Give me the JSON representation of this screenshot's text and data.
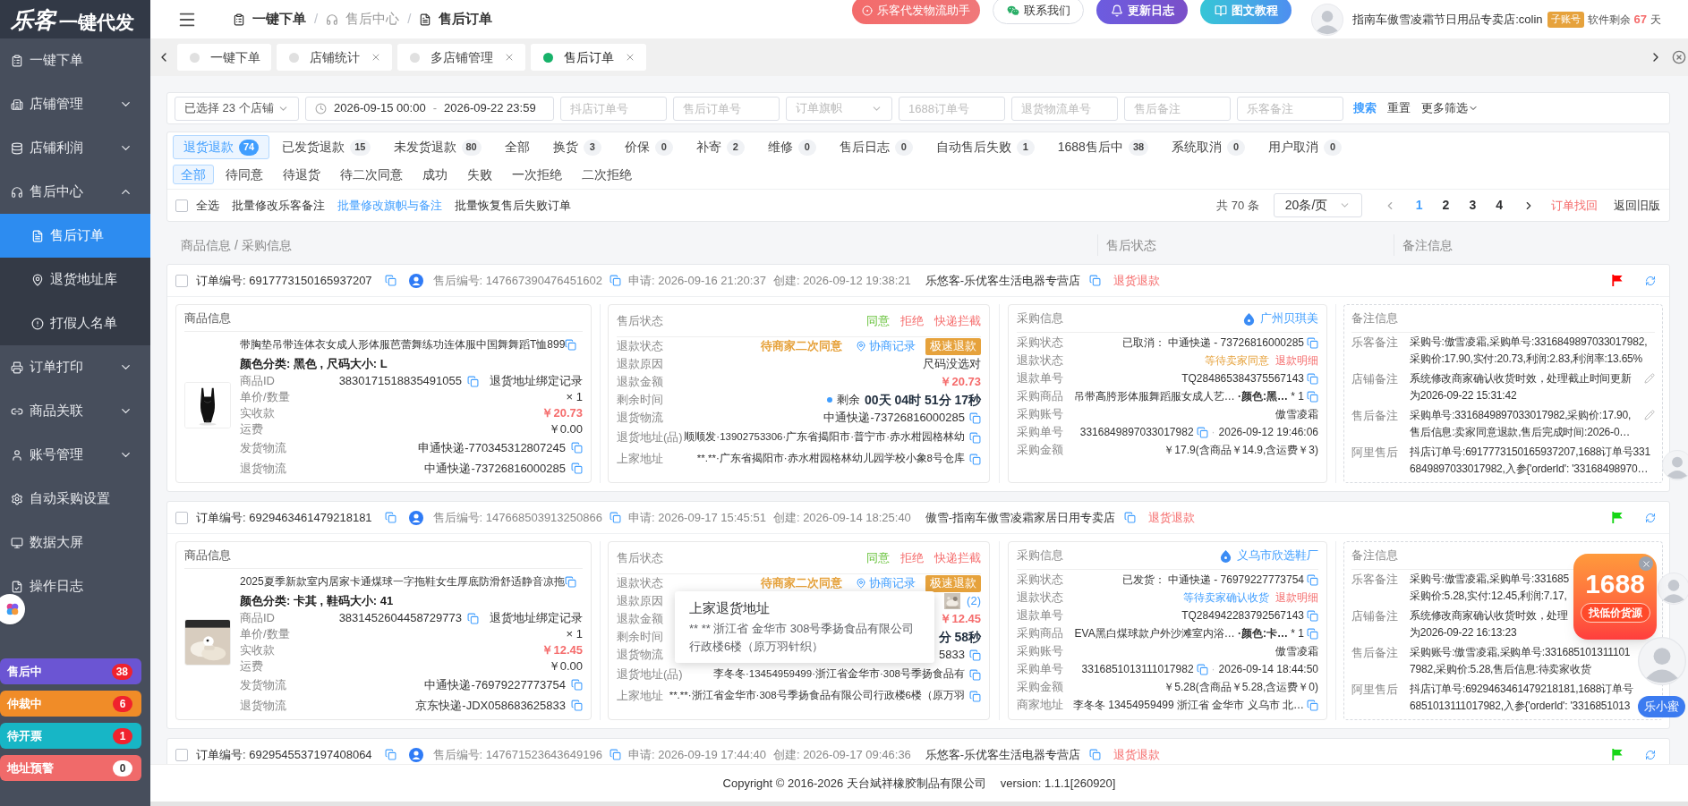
{
  "logo": {
    "brand": "乐客",
    "tagline": "一键代发"
  },
  "breadcrumb": {
    "separator": "/",
    "items": [
      {
        "label": "一键下单",
        "muted": false
      },
      {
        "label": "售后中心",
        "muted": true
      },
      {
        "label": "售后订单",
        "muted": false
      }
    ]
  },
  "header_buttons": [
    {
      "kind": "logistics",
      "label": "乐客代发物流助手"
    },
    {
      "kind": "contact",
      "label": "联系我们"
    },
    {
      "kind": "changelog",
      "label": "更新日志"
    },
    {
      "kind": "tutorial",
      "label": "图文教程"
    }
  ],
  "user": {
    "name": "指南车傲雪凌霜节日用品专卖店:colin",
    "badge": "子账号",
    "remaining": "软件剩余",
    "days": "67",
    "unit": "天"
  },
  "sidebar": {
    "items": [
      {
        "label": "一键下单",
        "selected": false
      },
      {
        "label": "店铺管理",
        "selected": false,
        "expanded": false
      },
      {
        "label": "店铺利润",
        "selected": false,
        "expanded": false
      },
      {
        "label": "售后中心",
        "selected": false,
        "expanded": true,
        "children": [
          {
            "label": "售后订单",
            "selected": true
          },
          {
            "label": "退货地址库",
            "selected": false
          },
          {
            "label": "打假人名单",
            "selected": false
          }
        ]
      },
      {
        "label": "订单打印",
        "selected": false,
        "expanded": false
      },
      {
        "label": "商品关联",
        "selected": false,
        "expanded": false
      },
      {
        "label": "账号管理",
        "selected": false,
        "expanded": false
      },
      {
        "label": "自动采购设置",
        "selected": false
      },
      {
        "label": "数据大屏",
        "selected": false
      },
      {
        "label": "操作日志",
        "selected": false
      }
    ],
    "counters": [
      {
        "label": "售后中",
        "count": "38",
        "alert": true,
        "color": "#6b55d3"
      },
      {
        "label": "仲裁中",
        "count": "6",
        "alert": true,
        "color": "#f08c28"
      },
      {
        "label": "待开票",
        "count": "1",
        "alert": true,
        "color": "#17b6c6"
      },
      {
        "label": "地址预警",
        "count": "0",
        "alert": false,
        "color": "#f06a6a"
      }
    ]
  },
  "page_tabs": [
    {
      "label": "一键下单",
      "selected": false,
      "closable": false
    },
    {
      "label": "店铺统计",
      "selected": false,
      "closable": true
    },
    {
      "label": "多店铺管理",
      "selected": false,
      "closable": true
    },
    {
      "label": "售后订单",
      "selected": true,
      "closable": true
    }
  ],
  "filters": {
    "store": "已选择 23 个店铺",
    "date_from": "2026-09-15 00:00",
    "date_separator": "-",
    "date_to": "2026-09-22 23:59",
    "fields": [
      {
        "kind": "input",
        "placeholder": "抖店订单号"
      },
      {
        "kind": "input",
        "placeholder": "售后订单号"
      },
      {
        "kind": "select",
        "placeholder": "订单旗帜"
      },
      {
        "kind": "input",
        "placeholder": "1688订单号"
      },
      {
        "kind": "input",
        "placeholder": "退货物流单号"
      },
      {
        "kind": "input",
        "placeholder": "售后备注"
      },
      {
        "kind": "input",
        "placeholder": "乐客备注"
      }
    ],
    "search": "搜索",
    "reset": "重置",
    "more": "更多筛选"
  },
  "type_tabs": [
    {
      "label": "退货退款",
      "count": "74",
      "selected": true
    },
    {
      "label": "已发货退款",
      "count": "15",
      "selected": false
    },
    {
      "label": "未发货退款",
      "count": "80",
      "selected": false
    },
    {
      "label": "全部",
      "selected": false
    },
    {
      "label": "换货",
      "count": "3",
      "selected": false
    },
    {
      "label": "价保",
      "count": "0",
      "selected": false
    },
    {
      "label": "补寄",
      "count": "2",
      "selected": false
    },
    {
      "label": "维修",
      "count": "0",
      "selected": false
    },
    {
      "label": "售后日志",
      "count": "0",
      "selected": false
    },
    {
      "label": "自动售后失败",
      "count": "1",
      "selected": false
    },
    {
      "label": "1688售后中",
      "count": "38",
      "selected": false
    },
    {
      "label": "系统取消",
      "count": "0",
      "selected": false
    },
    {
      "label": "用户取消",
      "count": "0",
      "selected": false
    }
  ],
  "sub_tabs": [
    {
      "label": "全部",
      "selected": true
    },
    {
      "label": "待同意",
      "selected": false
    },
    {
      "label": "待退货",
      "selected": false
    },
    {
      "label": "待二次同意",
      "selected": false
    },
    {
      "label": "成功",
      "selected": false
    },
    {
      "label": "失败",
      "selected": false
    },
    {
      "label": "一次拒绝",
      "selected": false
    },
    {
      "label": "二次拒绝",
      "selected": false
    }
  ],
  "toolbar": {
    "select_all": {
      "label": "全选",
      "checked": false
    },
    "actions": [
      {
        "label": "批量修改乐客备注",
        "kind": "plain"
      },
      {
        "label": "批量修改旗帜与备注",
        "kind": "link"
      },
      {
        "label": "批量恢复售后失败订单",
        "kind": "plain"
      }
    ]
  },
  "pagination": {
    "total": "共 70 条",
    "page_size": "20条/页",
    "pages": [
      {
        "label": "1",
        "selected": true
      },
      {
        "label": "2",
        "selected": false
      },
      {
        "label": "3",
        "selected": false
      },
      {
        "label": "4",
        "selected": false
      }
    ],
    "links": [
      {
        "label": "订单找回",
        "kind": "danger"
      },
      {
        "label": "返回旧版",
        "kind": "plain"
      }
    ]
  },
  "columns": [
    {
      "label": "商品信息 / 采购信息"
    },
    {
      "label": "售后状态"
    },
    {
      "label": "备注信息"
    }
  ],
  "orders": [
    {
      "checked": false,
      "order_no": "订单编号: 6917773150165937207",
      "after_sale": "售后编号: 147667390476451602",
      "applied": "申请: 2026-09-16 21:20:37",
      "created": "创建: 2026-09-12 19:38:21",
      "store": "乐悠客-乐优客生活电器专营店",
      "type": "退货退款",
      "flag": {
        "color": "#ff0000"
      },
      "product": {
        "title": "商品信息",
        "name": "带胸垫吊带连体衣女成人形体服芭蕾舞练功连体服中国舞舞蹈T恤899",
        "variant": "颜色分类: 黑色 , 尺码大小: L",
        "fields": [
          {
            "kind": "id",
            "label": "商品ID",
            "value": "3830171518835491055",
            "link": "退货地址绑定记录"
          },
          {
            "kind": "plain",
            "label": "单价/数量",
            "value": "× 1"
          },
          {
            "kind": "price",
            "label": "实收款",
            "value": "￥20.73"
          },
          {
            "kind": "plain",
            "label": "运费",
            "value": "￥0.00"
          },
          {
            "kind": "copy",
            "label": "发货物流",
            "value": "申通快递-770345312807245"
          },
          {
            "kind": "copy",
            "label": "退货物流",
            "value": "中通快递-73726816000285"
          }
        ]
      },
      "status": {
        "title": "售后状态",
        "actions": [
          {
            "label": "同意",
            "kind": "agree"
          },
          {
            "label": "拒绝",
            "kind": "reject"
          },
          {
            "label": "快递拦截",
            "kind": "reject"
          }
        ],
        "fields": [
          {
            "kind": "state",
            "label": "退款状态",
            "value": "待商家二次同意",
            "link": "协商记录",
            "badge": "极速退款"
          },
          {
            "kind": "plain",
            "label": "退款原因",
            "value": "尺码没选对"
          },
          {
            "kind": "price",
            "label": "退款金额",
            "value": "￥20.73"
          },
          {
            "kind": "countdown",
            "label": "剩余时间",
            "prefix": "剩余",
            "value": "00天 04时 51分 17秒"
          },
          {
            "kind": "copy",
            "label": "退货物流",
            "value": "中通快递-73726816000285"
          },
          {
            "kind": "address",
            "label": "退货地址(品)",
            "value": "顺顺发·13902753306·广东省揭阳市·普宁市·赤水柑园格林幼"
          },
          {
            "kind": "address",
            "label": "上家地址",
            "value": "**.**·广东省揭阳市·赤水柑园格林幼儿园学校小象8号仓库"
          }
        ]
      },
      "purchase": {
        "title": "采购信息",
        "supplier": "广州贝琪美",
        "fields": [
          {
            "kind": "copy",
            "label": "采购状态",
            "value": "已取消： 中通快递 - 73726816000285"
          },
          {
            "kind": "refund",
            "label": "退款状态",
            "value": "等待卖家同意",
            "in_transit": false,
            "link": "退款明细"
          },
          {
            "kind": "copy",
            "label": "退款单号",
            "value": "TQ284865384375567143"
          },
          {
            "kind": "copy",
            "label": "采购商品",
            "value": "吊带高胯形体服舞蹈服女成人艺… **·颜色:黑…** * 1"
          },
          {
            "kind": "plain",
            "label": "采购账号",
            "value": "傲雪凌霜"
          },
          {
            "kind": "order",
            "label": "采购单号",
            "value": "3316849897033017982",
            "separator": "·",
            "time": "2026-09-12 19:46:06"
          },
          {
            "kind": "plain",
            "label": "采购金额",
            "value": "￥17.9(含商品￥14.9,含运费￥3)"
          }
        ]
      },
      "remarks": {
        "title": "备注信息",
        "fields": [
          {
            "label": "乐客备注",
            "editable": false,
            "lines": [
              "采购号:傲雪凌霜,采购单号:3316849897033017982,",
              "采购价:17.90,实付:20.73,利润:2.83,利润率:13.65%"
            ]
          },
          {
            "label": "店铺备注",
            "editable": true,
            "lines": [
              "系统修改商家确认收货时效，处理截止时间更新",
              "为2026-09-22 15:31:42"
            ]
          },
          {
            "label": "售后备注",
            "editable": true,
            "lines": [
              "采购单号:3316849897033017982,采购价:17.90,",
              "售后信息:卖家同意退款,售后完成时间:2026-0…"
            ]
          },
          {
            "label": "阿里售后",
            "editable": false,
            "lines": [
              "抖店订单号:6917773150165937207,1688订单号331",
              "6849897033017982,入参{'orderId': '33168498970…"
            ]
          }
        ]
      }
    },
    {
      "checked": false,
      "order_no": "订单编号: 6929463461479218181",
      "after_sale": "售后编号: 147668503913250866",
      "applied": "申请: 2026-09-17 15:45:51",
      "created": "创建: 2026-09-14 18:25:40",
      "store": "傲雪-指南车傲雪凌霜家居日用专卖店",
      "type": "退货退款",
      "flag": {
        "color": "#16d616"
      },
      "product": {
        "title": "商品信息",
        "name": "2025夏季新款室内居家卡通煤球一字拖鞋女生厚底防滑舒适静音凉拖",
        "variant": "颜色分类: 卡其 , 鞋码大小: 41",
        "fields": [
          {
            "kind": "id",
            "label": "商品ID",
            "value": "3831452604458729773",
            "link": "退货地址绑定记录"
          },
          {
            "kind": "plain",
            "label": "单价/数量",
            "value": "× 1"
          },
          {
            "kind": "price",
            "label": "实收款",
            "value": "￥12.45"
          },
          {
            "kind": "plain",
            "label": "运费",
            "value": "￥0.00"
          },
          {
            "kind": "copy",
            "label": "发货物流",
            "value": "中通快递-76979227773754"
          },
          {
            "kind": "copy",
            "label": "退货物流",
            "value": "京东快递-JDX058683625833"
          }
        ]
      },
      "status": {
        "title": "售后状态",
        "actions": [
          {
            "label": "同意",
            "kind": "agree"
          },
          {
            "label": "拒绝",
            "kind": "reject"
          },
          {
            "label": "快递拦截",
            "kind": "reject"
          }
        ],
        "tooltip": {
          "title": "上家退货地址",
          "text": "** ** 浙江省 金华市 308号季扬食品有限公司行政楼6楼（原万羽针织）"
        },
        "fields": [
          {
            "kind": "state",
            "label": "退款状态",
            "value": "待商家二次同意",
            "link": "协商记录",
            "badge": "极速退款"
          },
          {
            "kind": "images",
            "label": "退款原因",
            "value": "(2)"
          },
          {
            "kind": "price",
            "label": "退款金额",
            "value": "￥12.45"
          },
          {
            "kind": "countdown",
            "label": "剩余时间",
            "value": "分 58秒"
          },
          {
            "kind": "copy",
            "label": "退货物流",
            "value": "5833"
          },
          {
            "kind": "address",
            "label": "退货地址(品)",
            "value": "李冬冬·13454959499·浙江省金华市·308号季扬食品有"
          },
          {
            "kind": "address",
            "label": "上家地址",
            "value": "**.**·浙江省金华市·308号季扬食品有限公司行政楼6楼（原万羽"
          }
        ]
      },
      "purchase": {
        "title": "采购信息",
        "supplier": "义乌市欣选鞋厂",
        "fields": [
          {
            "kind": "copy",
            "label": "采购状态",
            "value": "已发货： 中通快递 - 76979227773754"
          },
          {
            "kind": "refund",
            "label": "退款状态",
            "value": "等待卖家确认收货",
            "in_transit": true,
            "link": "退款明细"
          },
          {
            "kind": "copy",
            "label": "退款单号",
            "value": "TQ284942283792567143"
          },
          {
            "kind": "copy",
            "label": "采购商品",
            "value": "EVA黑白煤球款户外沙滩室内浴… **·颜色:卡…** * 1"
          },
          {
            "kind": "plain",
            "label": "采购账号",
            "value": "傲雪凌霜"
          },
          {
            "kind": "order",
            "label": "采购单号",
            "value": "3316851013111017982",
            "separator": "·",
            "time": "2026-09-14 18:44:50"
          },
          {
            "kind": "plain",
            "label": "采购金额",
            "value": "￥5.28(含商品￥5.28,含运费￥0)"
          },
          {
            "kind": "copy",
            "label": "商家地址",
            "value": "李冬冬 13454959499 浙江省 金华市 义乌市 北…"
          }
        ]
      },
      "remarks": {
        "title": "备注信息",
        "fields": [
          {
            "label": "乐客备注",
            "lines": [
              "采购号:傲雪凌霜,采购单号:331685",
              "采购价:5.28,实付:12.45,利润:7.17,"
            ]
          },
          {
            "label": "店铺备注",
            "lines": [
              "系统修改商家确认收货时效，处理",
              "为2026-09-22 16:13:23"
            ]
          },
          {
            "label": "售后备注",
            "lines": [
              "采购账号:傲雪凌霜,采购单号:331685101311101",
              "7982,采购价:5.28,售后信息:待卖家收货"
            ]
          },
          {
            "label": "阿里售后",
            "editable": false,
            "lines": [
              "抖店订单号:6929463461479218181,1688订单号",
              "6851013111017982,入参{'orderId': '3316851013"
            ]
          }
        ]
      }
    },
    {
      "checked": false,
      "order_no": "订单编号: 6929545537197408064",
      "after_sale": "售后编号: 147671523643649196",
      "applied": "申请: 2026-09-19 17:44:40",
      "created": "创建: 2026-09-17 09:46:36",
      "store": "乐悠客-乐优客生活电器专营店",
      "type": "退货退款",
      "flag": {
        "color": "#16d616"
      }
    }
  ],
  "footer": {
    "copyright": "Copyright © 2016-2026 天台斌祥橡胶制品有限公司",
    "version": "version: 1.1.1[260920]"
  },
  "promo": {
    "title": "1688",
    "button": "找低价货源"
  },
  "assistant": {
    "label": "乐小蜜"
  }
}
